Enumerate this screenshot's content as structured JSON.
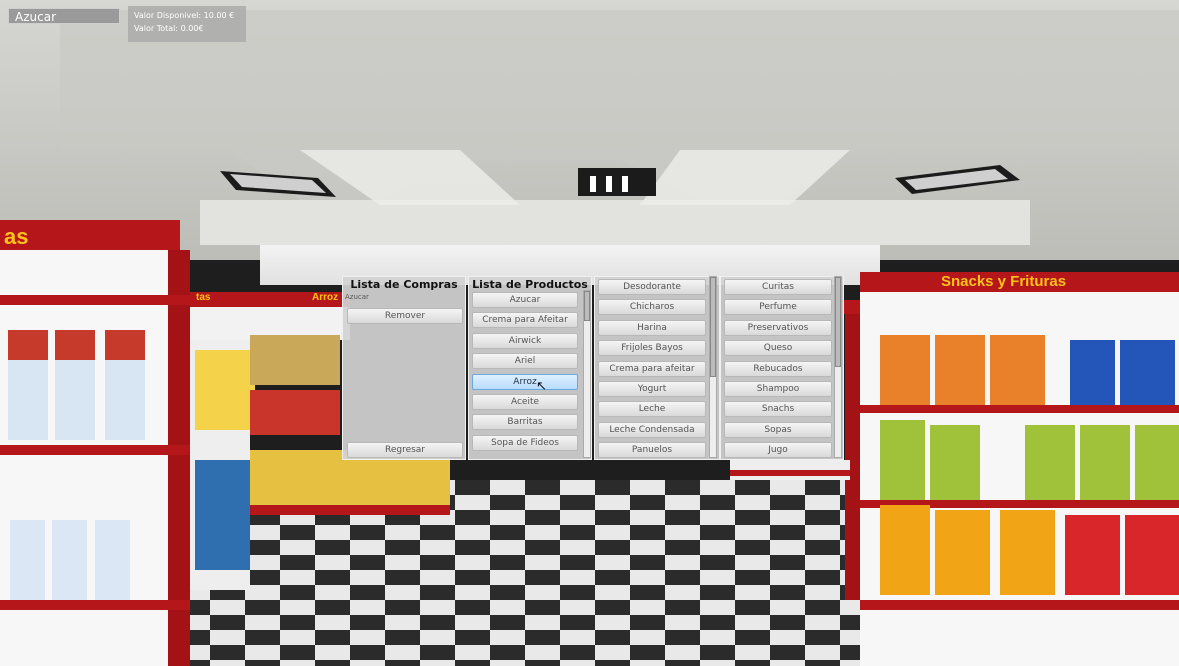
{
  "hud": {
    "item": "Azucar",
    "valor_disponible": "Valor Disponivel: 10.00 €",
    "valor_total": "Valor Total: 0.00€"
  },
  "store": {
    "sign_left": "as",
    "sign_back_left": "tas",
    "sign_back_mid": "Arroz",
    "sign_right": "Snacks y Frituras"
  },
  "compras": {
    "title": "Lista de Compras",
    "items": [
      "Azucar"
    ],
    "remover": "Remover",
    "regresar": "Regresar"
  },
  "productos": {
    "title": "Lista de Productos",
    "col1": [
      "Azucar",
      "Crema para Afeitar",
      "Airwick",
      "Ariel",
      "Arroz",
      "Aceite",
      "Barritas",
      "Sopa de Fideos"
    ],
    "col2": [
      "Desodorante",
      "Chicharos",
      "Harina",
      "Frijoles Bayos",
      "Crema para afeitar",
      "Yogurt",
      "Leche",
      "Leche Condensada",
      "Panuelos"
    ],
    "col3": [
      "Curitas",
      "Perfume",
      "Preservativos",
      "Queso",
      "Rebucados",
      "Shampoo",
      "Snachs",
      "Sopas",
      "Jugo"
    ],
    "selected": "Arroz"
  },
  "colors": {
    "shelf_red": "#b5161a",
    "sign_yellow": "#ffc21a",
    "floor_dark": "#2a2a2a",
    "floor_light": "#e8e8e8",
    "selected_blue": "#b8dcff"
  },
  "icons": {
    "cursor": "mouse-pointer-icon"
  }
}
